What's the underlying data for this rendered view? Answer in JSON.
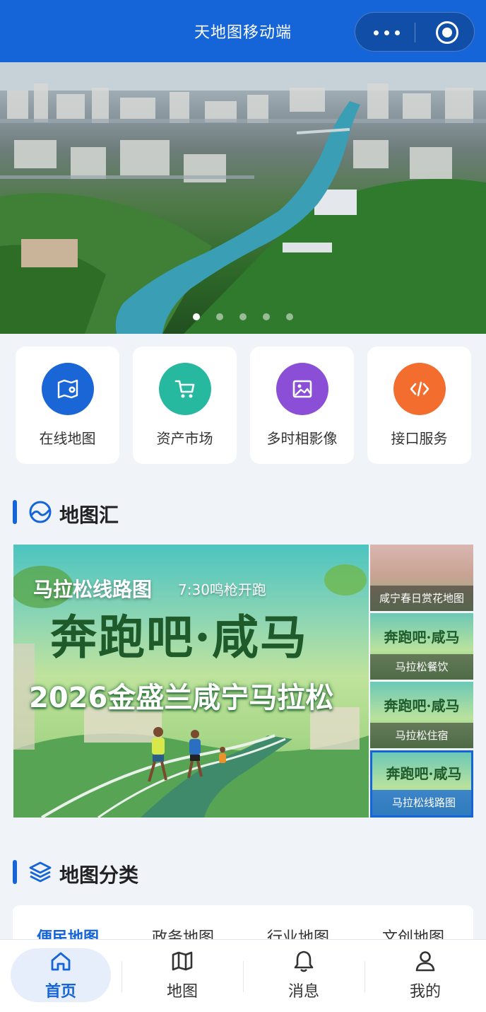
{
  "header": {
    "title": "天地图移动端",
    "more_icon": "more-dots-icon",
    "close_icon": "target-circle-icon"
  },
  "banner": {
    "slide_count": 5,
    "active_index": 0
  },
  "quick_links": [
    {
      "label": "在线地图",
      "icon": "map-pin-icon",
      "color": "#1a66d6"
    },
    {
      "label": "资产市场",
      "icon": "cart-icon",
      "color": "#26b9a0"
    },
    {
      "label": "多时相影像",
      "icon": "image-icon",
      "color": "#8a4fd6"
    },
    {
      "label": "接口服务",
      "icon": "code-icon",
      "color": "#f26d2e"
    }
  ],
  "map_collection": {
    "title": "地图汇",
    "feature": {
      "title": "马拉松线路图",
      "subtitle": "7:30鸣枪开跑",
      "headline": "奔跑吧·咸马",
      "event": "2026金盛兰咸宁马拉松"
    },
    "thumbnails": [
      {
        "caption": "咸宁春日赏花地图",
        "art_text": ""
      },
      {
        "caption": "马拉松餐饮",
        "art_text": "奔跑吧·咸马"
      },
      {
        "caption": "马拉松住宿",
        "art_text": "奔跑吧·咸马"
      },
      {
        "caption": "马拉松线路图",
        "art_text": "奔跑吧·咸马"
      }
    ]
  },
  "map_categories": {
    "title": "地图分类",
    "tabs": [
      "便民地图",
      "政务地图",
      "行业地图",
      "文创地图"
    ],
    "active": "便民地图"
  },
  "tabbar": {
    "items": [
      {
        "label": "首页",
        "icon": "home-icon"
      },
      {
        "label": "地图",
        "icon": "map-icon"
      },
      {
        "label": "消息",
        "icon": "bell-icon"
      },
      {
        "label": "我的",
        "icon": "user-icon"
      }
    ],
    "active": "首页"
  },
  "colors": {
    "primary": "#1565d8",
    "background": "#f0f3f8"
  }
}
